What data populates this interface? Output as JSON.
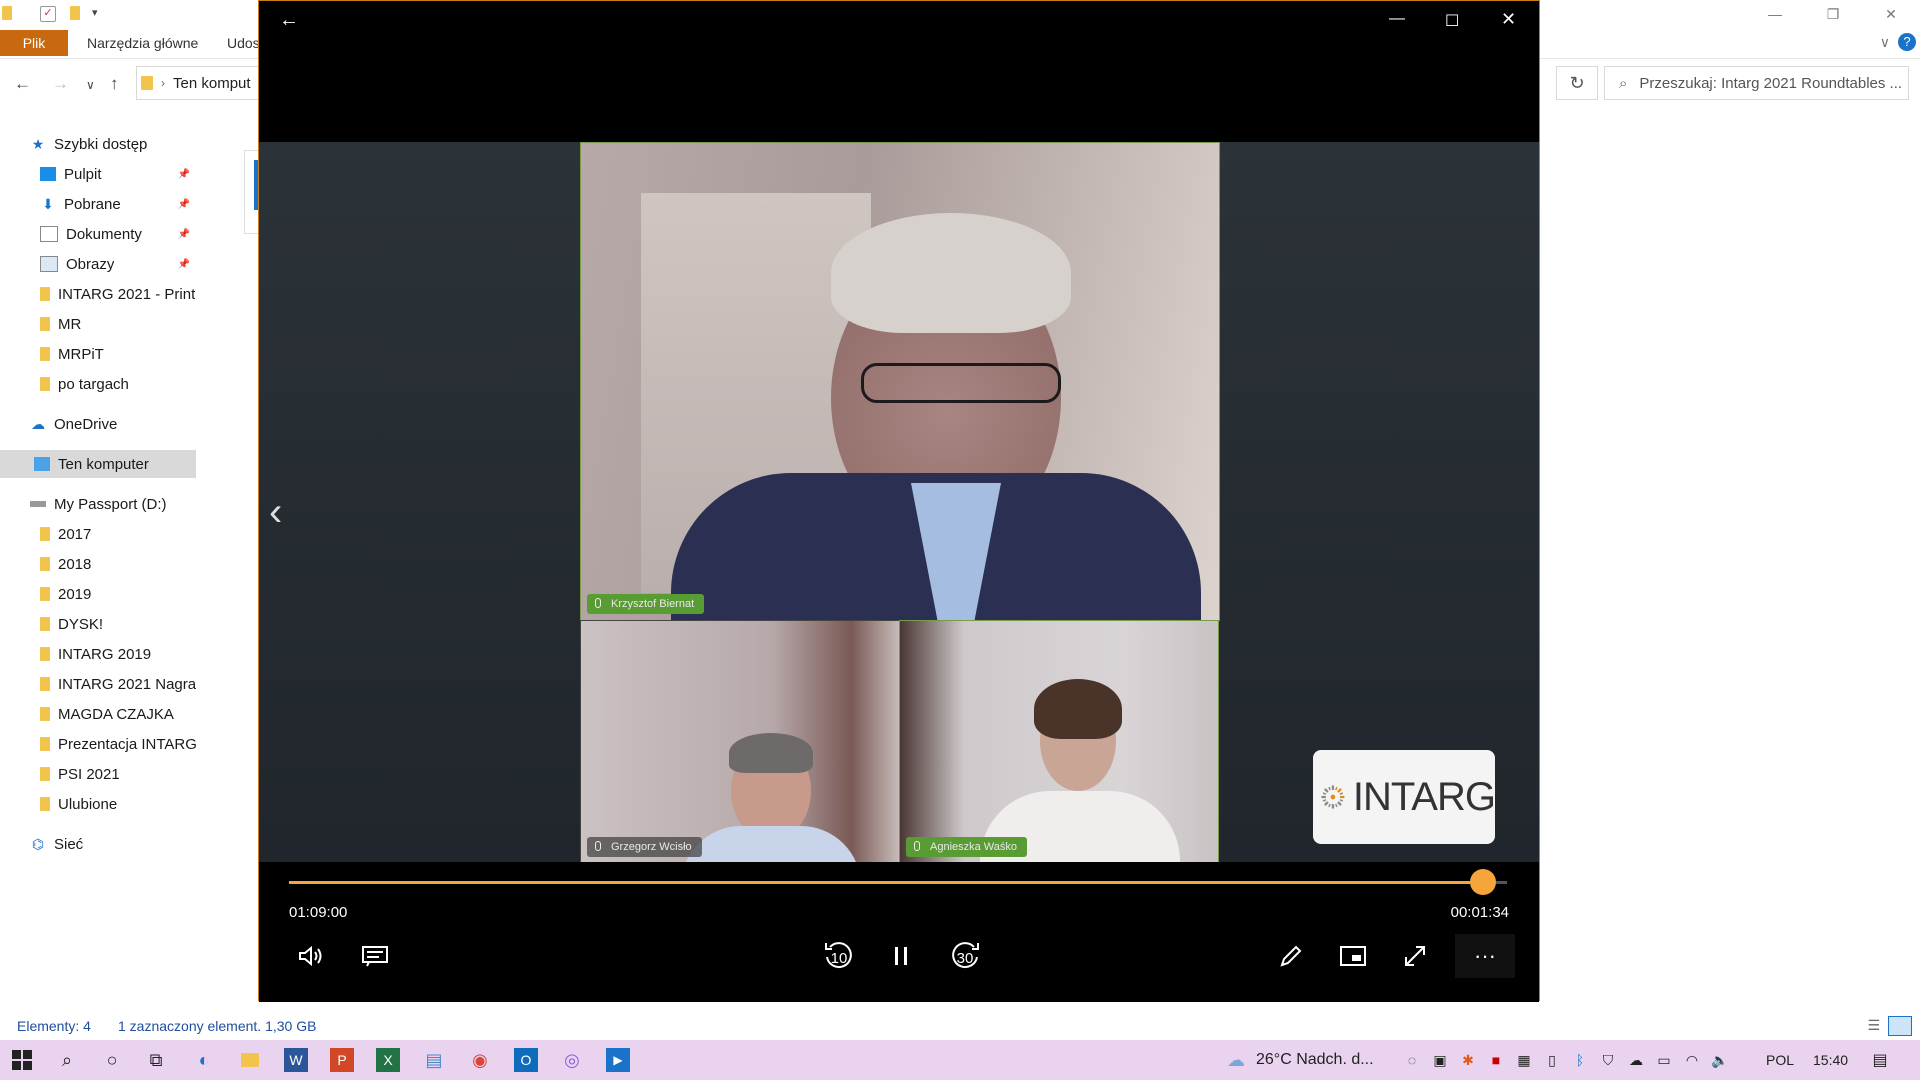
{
  "explorer": {
    "ribbon": {
      "file": "Plik",
      "home": "Narzędzia główne",
      "share": "Udos"
    },
    "address": "Ten komput",
    "search_placeholder": "Przeszukaj: Intarg 2021 Roundtables ...",
    "sidebar": [
      {
        "label": "Szybki dostęp",
        "icon": "star-icon"
      },
      {
        "label": "Pulpit",
        "icon": "desktop-icon",
        "pinned": true
      },
      {
        "label": "Pobrane",
        "icon": "download-icon",
        "pinned": true
      },
      {
        "label": "Dokumenty",
        "icon": "document-icon",
        "pinned": true
      },
      {
        "label": "Obrazy",
        "icon": "pictures-icon",
        "pinned": true
      },
      {
        "label": "INTARG 2021 - Print",
        "icon": "folder-icon"
      },
      {
        "label": "MR",
        "icon": "folder-icon"
      },
      {
        "label": "MRPiT",
        "icon": "folder-icon"
      },
      {
        "label": "po targach",
        "icon": "folder-icon"
      },
      {
        "label": "OneDrive",
        "icon": "cloud-icon"
      },
      {
        "label": "Ten komputer",
        "icon": "computer-icon",
        "selected": true
      },
      {
        "label": "My Passport (D:)",
        "icon": "drive-icon"
      },
      {
        "label": "2017",
        "icon": "folder-icon"
      },
      {
        "label": "2018",
        "icon": "folder-icon"
      },
      {
        "label": "2019",
        "icon": "folder-icon"
      },
      {
        "label": "DYSK!",
        "icon": "folder-icon"
      },
      {
        "label": "INTARG 2019",
        "icon": "folder-icon"
      },
      {
        "label": "INTARG 2021 Nagra",
        "icon": "folder-icon"
      },
      {
        "label": "MAGDA CZAJKA",
        "icon": "folder-icon"
      },
      {
        "label": "Prezentacja INTARG",
        "icon": "folder-icon"
      },
      {
        "label": "PSI 2021",
        "icon": "folder-icon"
      },
      {
        "label": "Ulubione",
        "icon": "folder-icon"
      },
      {
        "label": "Sieć",
        "icon": "network-icon"
      }
    ],
    "status": {
      "count": "Elementy: 4",
      "selected": "1 zaznaczony element. 1,30 GB"
    }
  },
  "player": {
    "participants": [
      {
        "name": "Krzysztof Biernat"
      },
      {
        "name": "Grzegorz Wcisło"
      },
      {
        "name": "Agnieszka Waśko"
      }
    ],
    "logo_text": "INTARG",
    "elapsed": "01:09:00",
    "remaining": "00:01:34",
    "progress": 0.98,
    "accent": "#f5a53a",
    "rewind_label": "10",
    "forward_label": "30"
  },
  "taskbar": {
    "weather": "26°C  Nadch. d...",
    "lang": "POL",
    "clock": "15:40",
    "color": "#e9d3ee"
  }
}
